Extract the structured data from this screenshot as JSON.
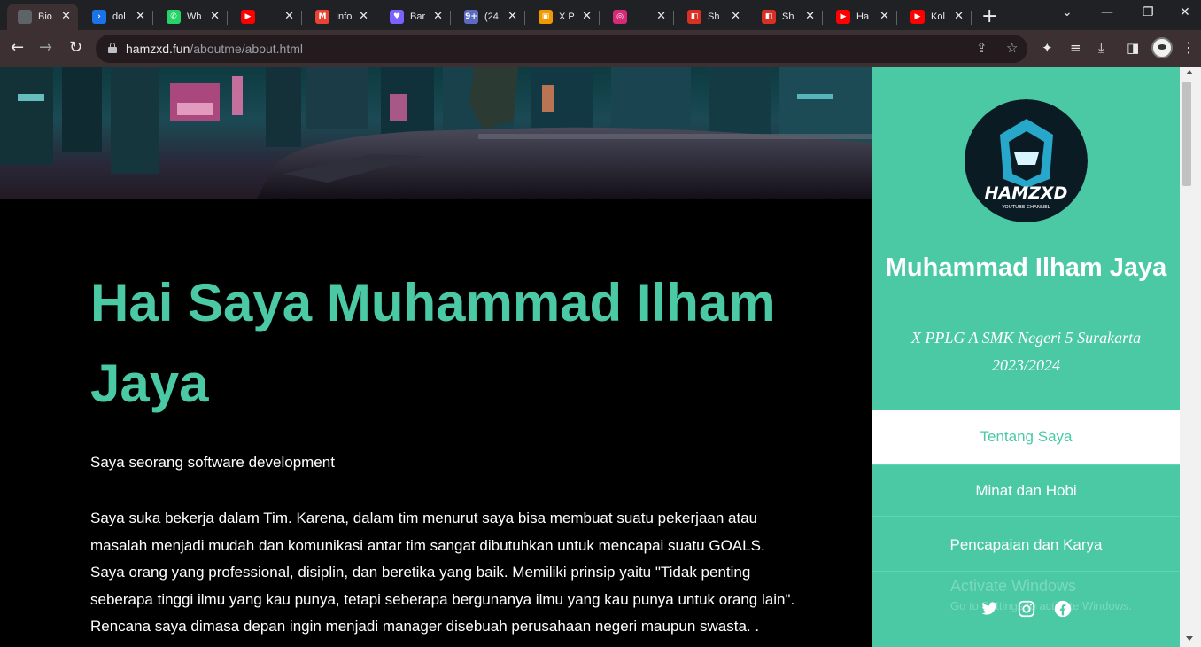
{
  "browser": {
    "tabs": [
      {
        "label": "Bio",
        "icon": "globe-icon",
        "color": "#5f6368",
        "glyph": ""
      },
      {
        "label": "dol",
        "icon": "chevron-logo-icon",
        "color": "#1a73e8",
        "glyph": "›"
      },
      {
        "label": "Wh",
        "icon": "whatsapp-icon",
        "color": "#25d366",
        "glyph": "✆"
      },
      {
        "label": "",
        "icon": "youtube-icon",
        "color": "#ff0000",
        "glyph": "▶"
      },
      {
        "label": "Info",
        "icon": "gmail-icon",
        "color": "#ea4335",
        "glyph": "M"
      },
      {
        "label": "Bar",
        "icon": "heart-app-icon",
        "color": "#7b61ff",
        "glyph": "♥"
      },
      {
        "label": "(24",
        "icon": "notification-icon",
        "color": "#5c6bc0",
        "glyph": "9+"
      },
      {
        "label": "X P",
        "icon": "profile-card-icon",
        "color": "#f29900",
        "glyph": "▣"
      },
      {
        "label": "",
        "icon": "instagram-icon",
        "color": "#d62976",
        "glyph": "◎"
      },
      {
        "label": "Sh",
        "icon": "shopping-bag-icon",
        "color": "#d93025",
        "glyph": "◧"
      },
      {
        "label": "Sh",
        "icon": "shopping-bag-icon",
        "color": "#d93025",
        "glyph": "◧"
      },
      {
        "label": "Ha",
        "icon": "youtube-icon",
        "color": "#ff0000",
        "glyph": "▶"
      },
      {
        "label": "Kol",
        "icon": "youtube-icon",
        "color": "#ff0000",
        "glyph": "▶"
      }
    ],
    "url_host": "hamzxd.fun",
    "url_path": "/aboutme/about.html"
  },
  "main": {
    "headline": "Hai Saya Muhammad Ilham Jaya",
    "intro": "Saya seorang software development",
    "paragraph": "Saya suka bekerja dalam Tim. Karena, dalam tim menurut saya bisa membuat suatu pekerjaan atau masalah menjadi mudah dan komunikasi antar tim sangat dibutuhkan untuk mencapai suatu GOALS. Saya orang yang professional, disiplin, dan beretika yang baik. Memiliki prinsip yaitu \"Tidak penting seberapa tinggi ilmu yang kau punya, tetapi seberapa bergunanya ilmu yang kau punya untuk orang lain\". Rencana saya dimasa depan ingin menjadi manager disebuah perusahaan negeri maupun swasta. ."
  },
  "sidebar": {
    "logo_text": "HAMZXD",
    "logo_subtext": "YOUTUBE CHANNEL",
    "name": "Muhammad Ilham Jaya",
    "subtitle_line1": "X PPLG A SMK Negeri 5 Surakarta",
    "subtitle_line2": "2023/2024",
    "menu": [
      {
        "label": "Tentang Saya",
        "active": true
      },
      {
        "label": "Minat dan Hobi",
        "active": false
      },
      {
        "label": "Pencapaian dan Karya",
        "active": false
      }
    ],
    "social": [
      "twitter-icon",
      "instagram-icon",
      "facebook-icon"
    ]
  },
  "watermark": {
    "line1": "Activate Windows",
    "line2": "Go to Settings to activate Windows."
  },
  "colors": {
    "accent": "#4ac9a4",
    "page_bg": "#000000",
    "chrome_dark": "#202124",
    "chrome_toolbar": "#3c3033"
  }
}
